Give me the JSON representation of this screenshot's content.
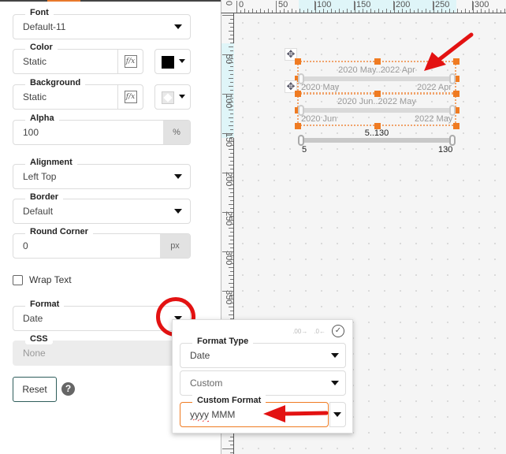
{
  "panel": {
    "font": {
      "label": "Font",
      "value": "Default-11"
    },
    "color": {
      "label": "Color",
      "value": "Static",
      "swatch": "#000000"
    },
    "background": {
      "label": "Background",
      "value": "Static",
      "swatch": "transparent"
    },
    "alpha": {
      "label": "Alpha",
      "value": "100",
      "unit": "%"
    },
    "alignment": {
      "label": "Alignment",
      "value": "Left Top"
    },
    "border": {
      "label": "Border",
      "value": "Default"
    },
    "round_corner": {
      "label": "Round Corner",
      "value": "0",
      "unit": "px"
    },
    "wrap_text": {
      "label": "Wrap Text",
      "checked": false
    },
    "format": {
      "label": "Format",
      "value": "Date"
    },
    "css": {
      "label": "CSS",
      "value": "None"
    },
    "reset_label": "Reset",
    "help_glyph": "?",
    "fx_glyph": "f/x"
  },
  "rulers": {
    "horizontal": [
      "0",
      "50",
      "100",
      "150",
      "200",
      "250",
      "300"
    ],
    "vertical": [
      "0",
      "50",
      "100",
      "150",
      "200",
      "250",
      "300",
      "350"
    ]
  },
  "canvas": {
    "sliders": [
      {
        "title": "2020 May..2022 Apr",
        "min_label": "2020 May",
        "max_label": "2022 Apr",
        "selected": true
      },
      {
        "title": "2020 Jun..2022 May",
        "min_label": "2020 Jun",
        "max_label": "2022 May",
        "selected": true
      },
      {
        "title": "5..130",
        "min_label": "5",
        "max_label": "130",
        "selected": false
      }
    ]
  },
  "format_popup": {
    "decimal_increase": ".00→",
    "decimal_decrease": ".0←",
    "apply_glyph": "✓",
    "format_type": {
      "label": "Format Type",
      "value": "Date"
    },
    "preset": {
      "value": "Custom"
    },
    "custom_format": {
      "label": "Custom Format",
      "value_misspelled": "yyyy",
      "value_rest": " MMM"
    }
  },
  "colors": {
    "accent": "#ef7b22",
    "annotation_red": "#e31212",
    "reset_border": "#2e5d5b"
  }
}
